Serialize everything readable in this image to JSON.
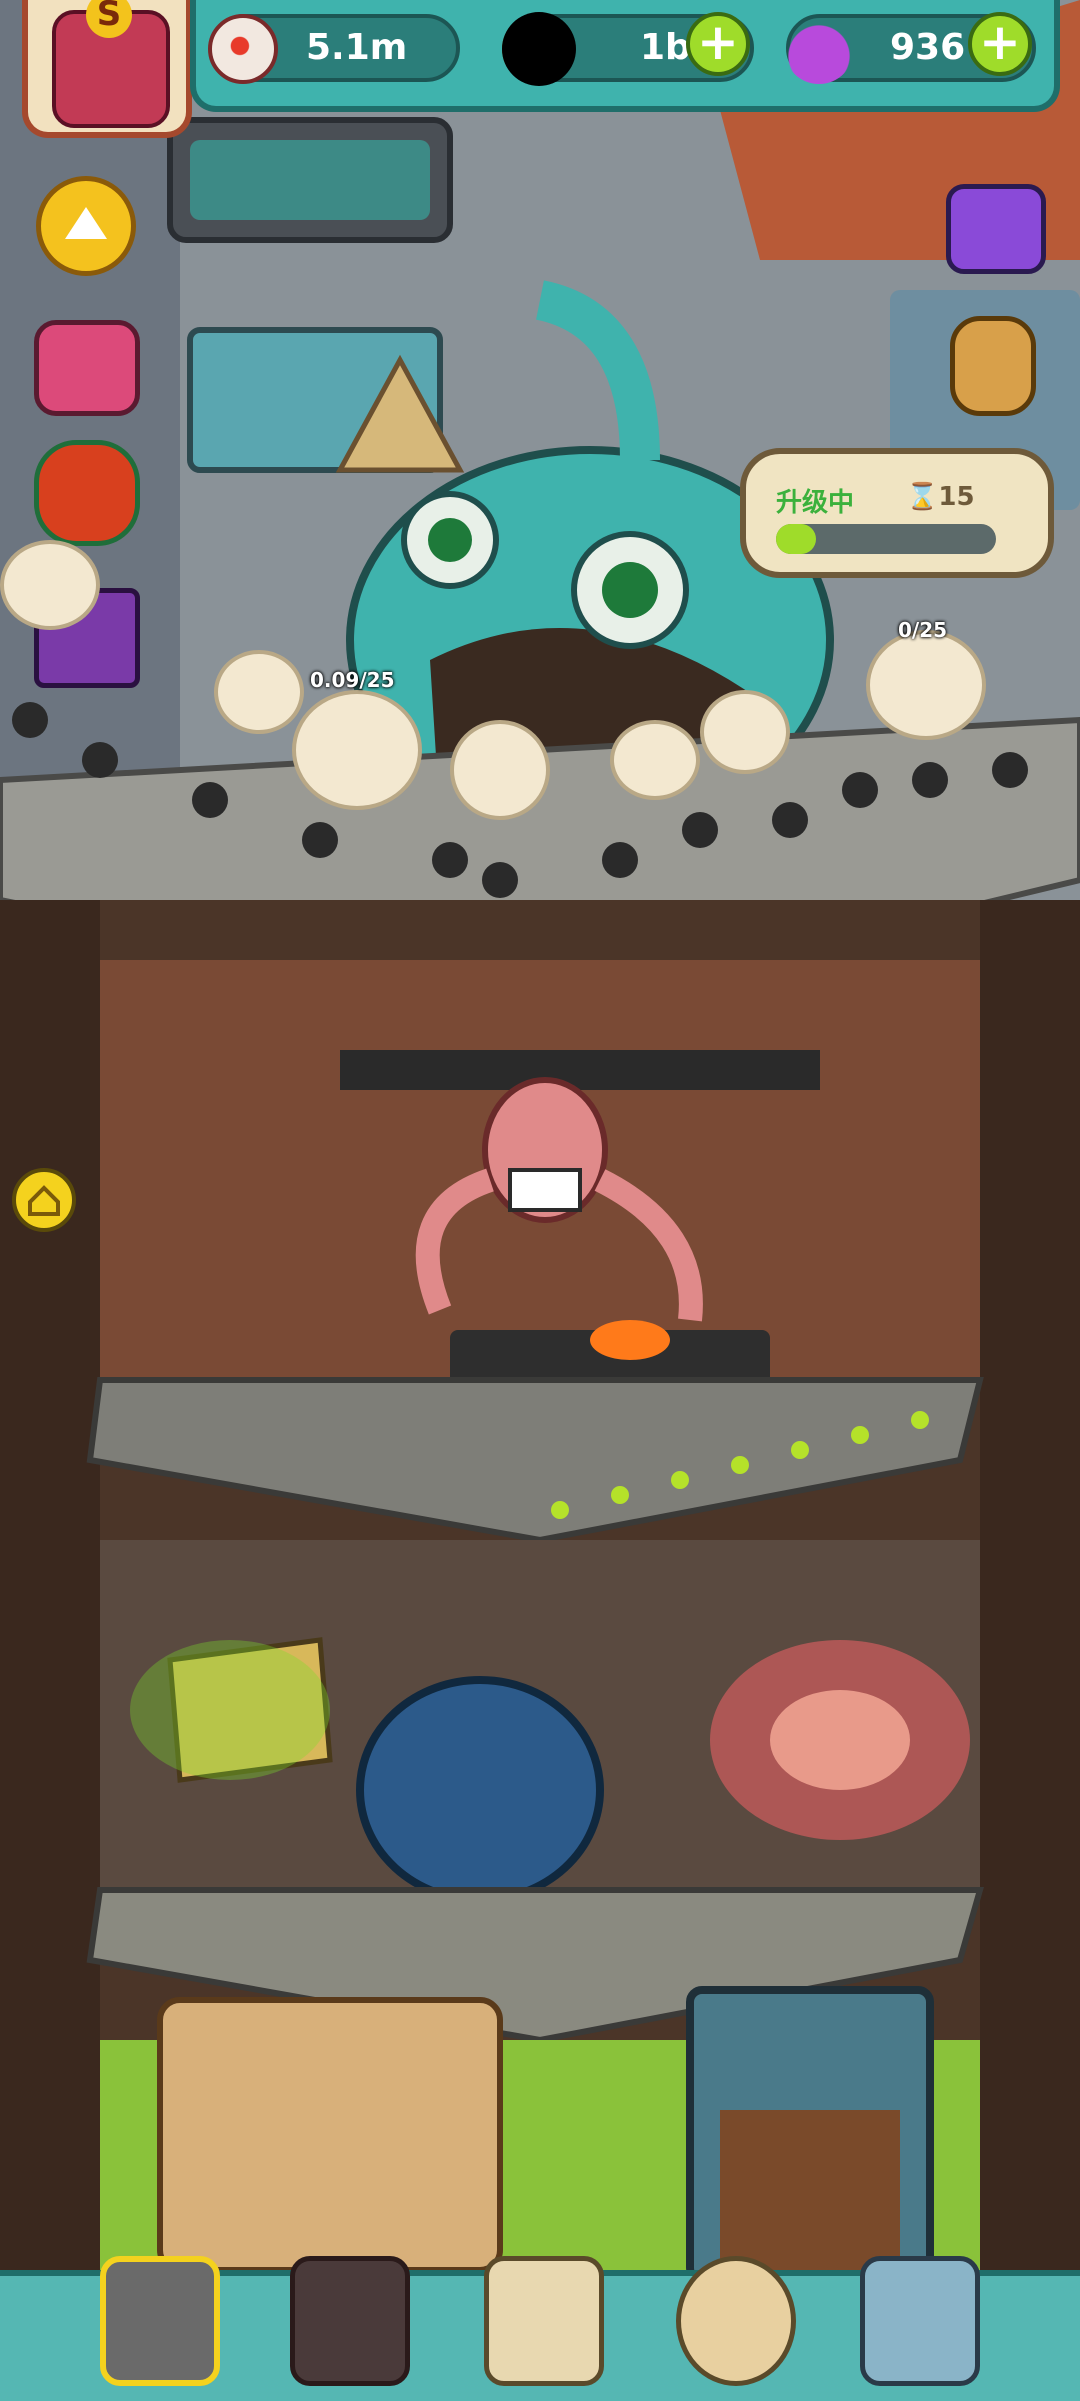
{
  "hud": {
    "eyeballs": "5.1m",
    "coins": "1b",
    "potions": "936",
    "add_coins_label": "+",
    "add_potions_label": "+",
    "avatar_rank": "S"
  },
  "upgrade_bubble": {
    "status": "升级中",
    "timer": "15",
    "progress": 0.18
  },
  "customer_counters": {
    "left": "0.09/25",
    "right": "0/25"
  },
  "colors": {
    "hud_teal": "#3fb3ad",
    "plus_green": "#9fdc2a",
    "progress_green": "#9fdc2a",
    "upgrade_text": "#3bb13c"
  },
  "icons": {
    "eyeball": "eyeball-icon",
    "coin": "coin-icon",
    "potion": "potion-icon",
    "home": "home-icon",
    "arrow_up": "arrow-up-icon"
  },
  "nav": {
    "items": [
      "restaurant",
      "monster",
      "recipe-book",
      "money-bag",
      "grid-menu"
    ]
  }
}
